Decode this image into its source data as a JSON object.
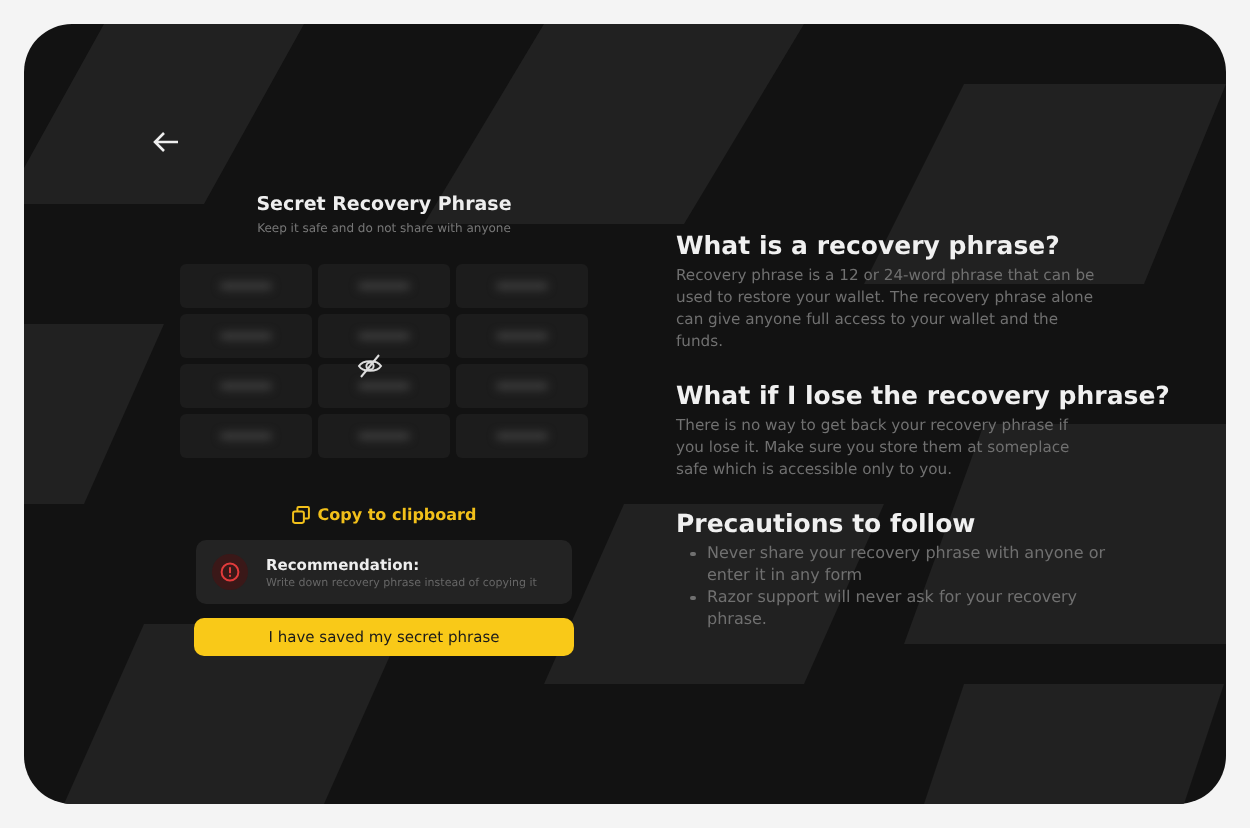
{
  "back_button": {
    "kind": "arrow"
  },
  "phrase_panel": {
    "title": "Secret Recovery Phrase",
    "subtitle": "Keep it safe and do not share with anyone",
    "hidden": true,
    "words": [
      {
        "kind": "masked"
      },
      {
        "kind": "masked"
      },
      {
        "kind": "masked"
      },
      {
        "kind": "masked"
      },
      {
        "kind": "masked"
      },
      {
        "kind": "masked"
      },
      {
        "kind": "masked"
      },
      {
        "kind": "masked"
      },
      {
        "kind": "masked"
      },
      {
        "kind": "masked"
      },
      {
        "kind": "masked"
      },
      {
        "kind": "masked"
      }
    ]
  },
  "copy_button": {
    "label": "Copy to clipboard"
  },
  "recommendation": {
    "title": "Recommendation:",
    "text": "Write down recovery phrase instead of copying it"
  },
  "confirm_button": {
    "label": "I have saved my secret phrase"
  },
  "info_sections": [
    {
      "heading": "What is a recovery phrase?",
      "text": "Recovery phrase is a 12 or 24-word phrase that can be used to restore your wallet. The recovery phrase alone can give anyone full access to your wallet and the funds."
    },
    {
      "heading": "What if I lose the recovery phrase?",
      "text": "There is no way to get back your recovery phrase if you lose it. Make sure you store them at someplace safe which is accessible only to you."
    },
    {
      "heading": "Precautions to follow",
      "bullets": [
        "Never share your recovery phrase with anyone or enter it in any form",
        "Razor support will never ask for your recovery phrase."
      ]
    }
  ]
}
